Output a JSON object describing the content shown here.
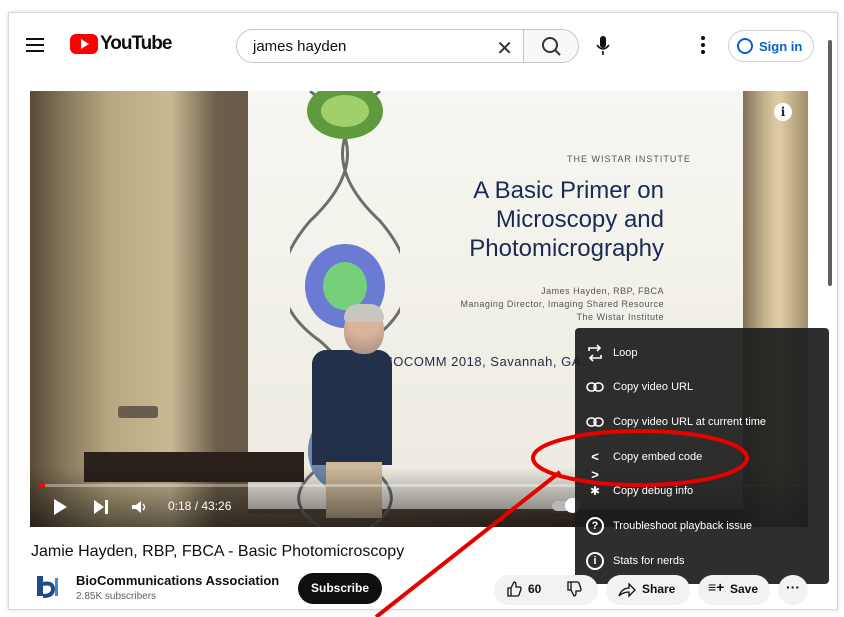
{
  "header": {
    "logo_text": "YouTube",
    "search_value": "james hayden",
    "search_clear_glyph": "✕",
    "signin_label": "Sign in"
  },
  "player": {
    "info_glyph": "i",
    "slide": {
      "logo_text": "THE WISTAR INSTITUTE",
      "title_lines": [
        "A Basic Primer on",
        "Microscopy and",
        "Photomicrography"
      ],
      "author_lines": [
        "James Hayden, RBP, FBCA",
        "Managing Director, Imaging Shared Resource",
        "The Wistar Institute"
      ],
      "footer": "BIOCOMM 2018, Savannah, GA"
    },
    "time": "0:18 / 43:26",
    "progress_fraction": 0.007
  },
  "context_menu": {
    "items": [
      {
        "label": "Loop",
        "icon": "loop-icon"
      },
      {
        "label": "Copy video URL",
        "icon": "link-icon"
      },
      {
        "label": "Copy video URL at current time",
        "icon": "link-icon"
      },
      {
        "label": "Copy embed code",
        "icon": "code-icon"
      },
      {
        "label": "Copy debug info",
        "icon": "debug-icon"
      },
      {
        "label": "Troubleshoot playback issue",
        "icon": "help-icon"
      },
      {
        "label": "Stats for nerds",
        "icon": "info-icon"
      }
    ]
  },
  "video_meta": {
    "title": "Jamie Hayden, RBP, FBCA - Basic Photomicroscopy",
    "channel_name": "BioCommunications Association",
    "subscribers": "2.85K subscribers",
    "subscribe_label": "Subscribe",
    "like_count": "60",
    "share_label": "Share",
    "save_label": "Save",
    "more_glyph": "···"
  },
  "annotation": {
    "color": "#e60000",
    "highlighted_item": "Copy embed code"
  }
}
